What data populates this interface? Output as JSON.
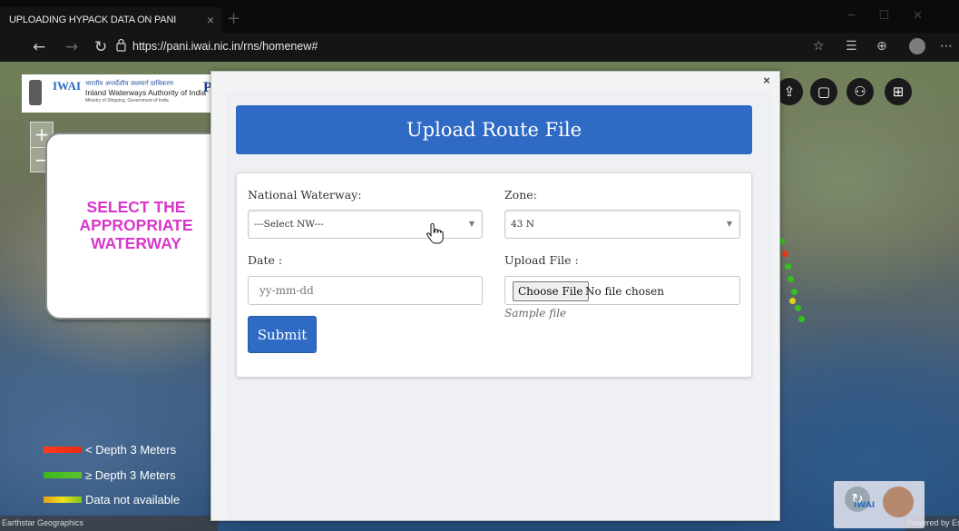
{
  "browser": {
    "tab_title": "UPLOADING HYPACK DATA ON PANI",
    "url": "https://pani.iwai.nic.in/rns/homenew#",
    "new_tab_symbol": "+",
    "tab_close": "×"
  },
  "site_header": {
    "logo_short": "IWAI",
    "org_name_hindi": "भारतीय अन्तर्देशीय जलमार्ग प्राधिकरण",
    "org_name": "Inland Waterways Authority of India",
    "ministry": "Ministry of Shipping, Government of India",
    "brand_initial": "P"
  },
  "map": {
    "zoom_in": "+",
    "zoom_out": "−",
    "attribution_left": "Earthstar Geographics",
    "attribution_right": "Powered by Esri",
    "toolbar_icons": [
      "upload-icon",
      "folder-icon",
      "users-icon",
      "grid-icon"
    ],
    "legend": [
      {
        "label": "< Depth 3 Meters",
        "color": "#ee2a1a"
      },
      {
        "label": "≥ Depth 3 Meters",
        "color": "#44b51c"
      },
      {
        "label": "Data not available",
        "color": "#e3d21a"
      }
    ]
  },
  "callout": {
    "text": "SELECT THE APPROPRIATE WATERWAY"
  },
  "modal": {
    "close": "×",
    "title": "Upload Route File",
    "national_waterway_label": "National Waterway:",
    "national_waterway_value": "---Select NW---",
    "zone_label": "Zone:",
    "zone_value": "43 N",
    "date_label": "Date :",
    "date_placeholder": "yy-mm-dd",
    "upload_label": "Upload File :",
    "choose_file": "Choose File",
    "no_file": "No file chosen",
    "sample_file": "Sample file",
    "submit": "Submit"
  },
  "colors": {
    "accent": "#2f6ac4",
    "callout_text": "#d937c9"
  }
}
